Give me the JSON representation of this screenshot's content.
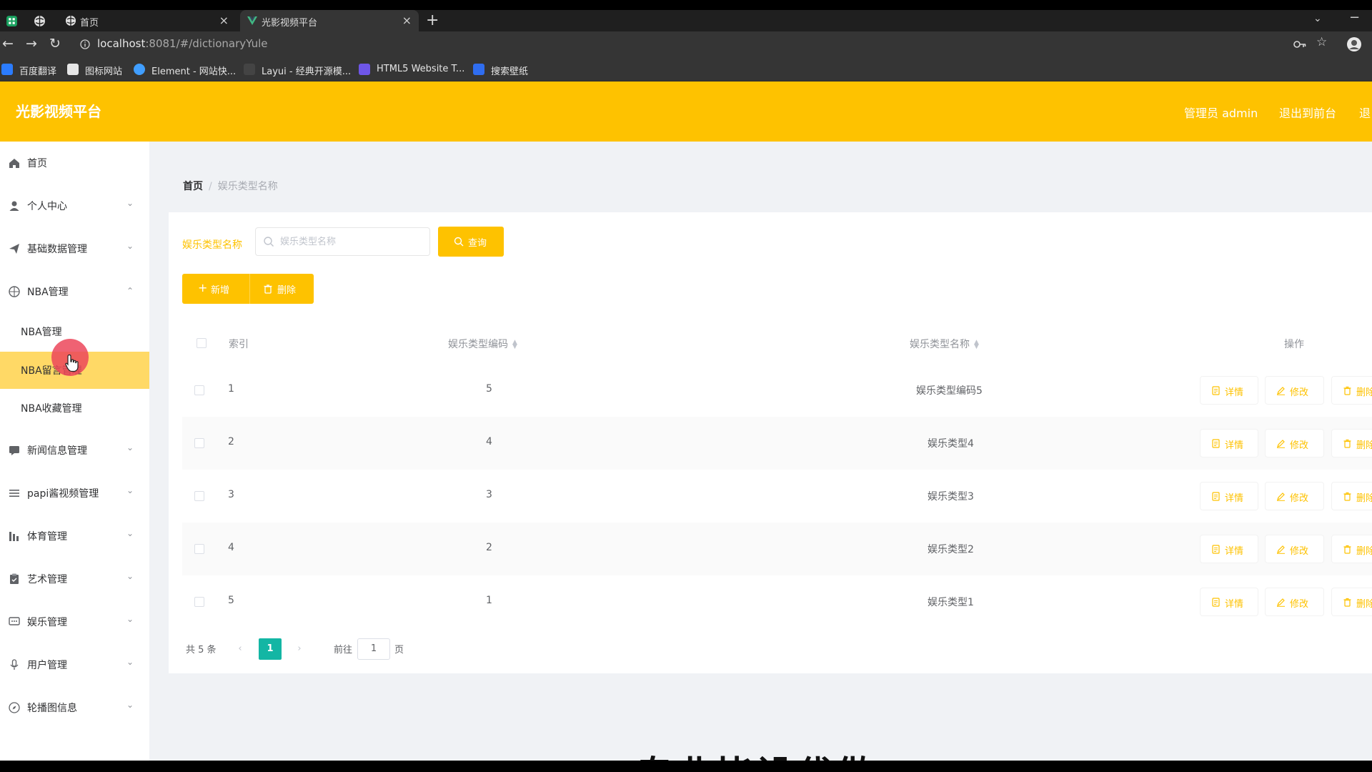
{
  "browser": {
    "tabs": [
      {
        "title": "首页"
      },
      {
        "title": "光影视频平台"
      }
    ],
    "url_host": "localhost",
    "url_rest": ":8081/#/dictionaryYule",
    "bookmarks": [
      "百度翻译",
      "图标网站",
      "Element - 网站快...",
      "Layui - 经典开源模...",
      "HTML5 Website T...",
      "搜索壁纸"
    ]
  },
  "header": {
    "brand": "光影视频平台",
    "user_label": "管理员 admin",
    "front_link": "退出到前台",
    "logout_link": "退"
  },
  "sidebar": {
    "items": [
      {
        "label": "首页",
        "icon": "home-icon"
      },
      {
        "label": "个人中心",
        "icon": "user-icon"
      },
      {
        "label": "基础数据管理",
        "icon": "send-icon"
      },
      {
        "label": "NBA管理",
        "icon": "basketball-icon"
      },
      {
        "label": "新闻信息管理",
        "icon": "message-icon"
      },
      {
        "label": "papi酱视频管理",
        "icon": "list-icon"
      },
      {
        "label": "体育管理",
        "icon": "chart-icon"
      },
      {
        "label": "艺术管理",
        "icon": "clipboard-icon"
      },
      {
        "label": "娱乐管理",
        "icon": "chat-icon"
      },
      {
        "label": "用户管理",
        "icon": "mic-icon"
      },
      {
        "label": "轮播图信息",
        "icon": "compass-icon"
      }
    ],
    "subitems": [
      "NBA管理",
      "NBA留言管理",
      "NBA收藏管理"
    ]
  },
  "breadcrumb": {
    "home": "首页",
    "separator": "/",
    "current": "娱乐类型名称"
  },
  "search": {
    "label": "娱乐类型名称",
    "placeholder": "娱乐类型名称",
    "value": "",
    "button": "查询"
  },
  "actions": {
    "add": "新增",
    "delete": "删除"
  },
  "table": {
    "headers": {
      "index": "索引",
      "code": "娱乐类型编码",
      "name": "娱乐类型名称",
      "ops": "操作"
    },
    "rows": [
      {
        "index": "1",
        "code": "5",
        "name": "娱乐类型编码5"
      },
      {
        "index": "2",
        "code": "4",
        "name": "娱乐类型4"
      },
      {
        "index": "3",
        "code": "3",
        "name": "娱乐类型3"
      },
      {
        "index": "4",
        "code": "2",
        "name": "娱乐类型2"
      },
      {
        "index": "5",
        "code": "1",
        "name": "娱乐类型1"
      }
    ],
    "row_actions": {
      "detail": "详情",
      "edit": "修改",
      "delete": "删除"
    }
  },
  "pagination": {
    "total": "共 5 条",
    "current_page": "1",
    "goto_label": "前往",
    "goto_value": "1",
    "page_unit": "页"
  },
  "overlay_text": "专业毕设代做",
  "colors": {
    "accent": "#fec200",
    "active_menu": "#ffd966",
    "pager_active": "#13b6a4"
  }
}
